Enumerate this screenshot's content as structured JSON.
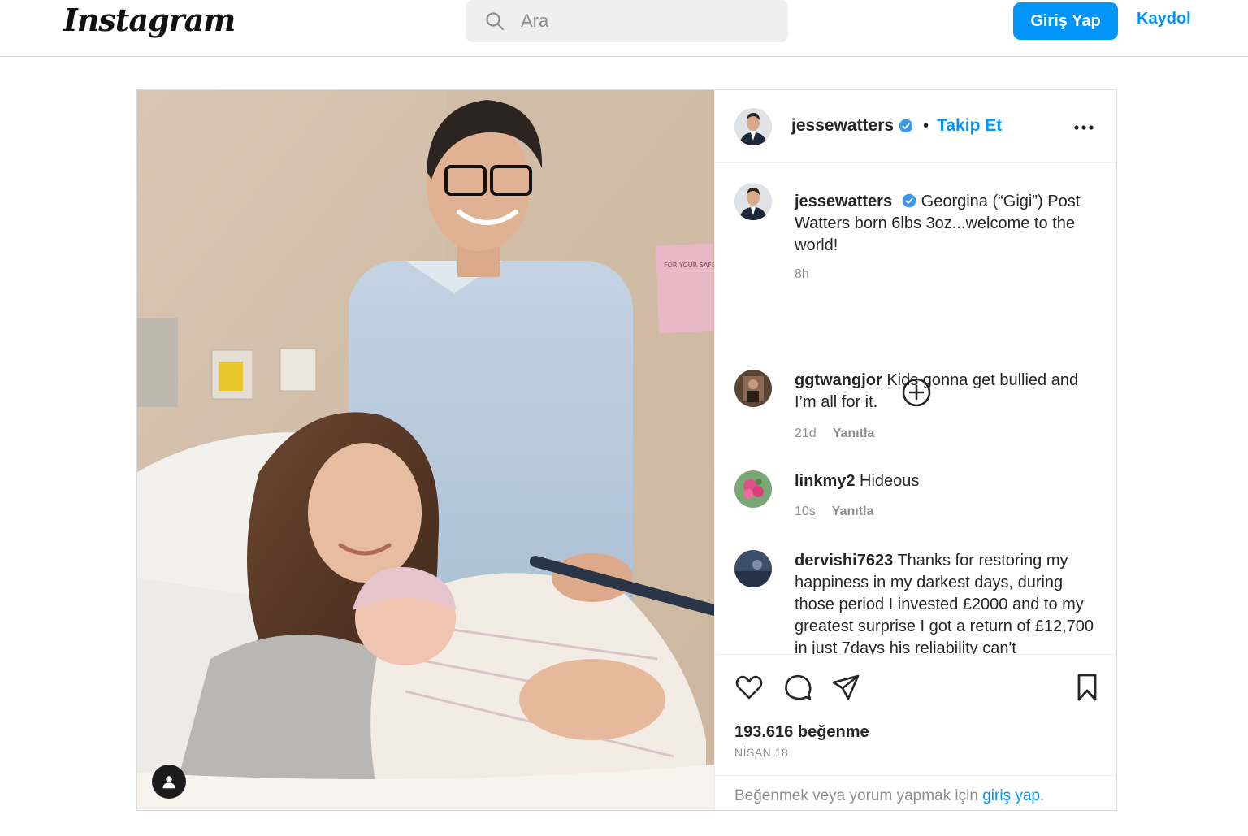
{
  "header": {
    "logo_text": "Instagram",
    "search_placeholder": "Ara",
    "login_label": "Giriş Yap",
    "signup_label": "Kaydol"
  },
  "post": {
    "author": "jessewatters",
    "follow_label": "Takip Et",
    "separator": "•",
    "caption": {
      "username": "jessewatters",
      "text": "Georgina (“Gigi”) Post Watters born 6lbs 3oz...welcome to the world!",
      "time": "8h"
    },
    "sign_text": "FOR YOUR SAFETY / WE ARE REQUESTING / WEAR YOUR MASK / TIMES EXCEPT / THANK",
    "comments": [
      {
        "username": "ggtwangjor",
        "text": "Kids gonna get bullied and I’m all for it.",
        "time": "21d",
        "reply_label": "Yanıtla"
      },
      {
        "username": "linkmy2",
        "text": "Hideous",
        "time": "10s",
        "reply_label": "Yanıtla"
      },
      {
        "username": "dervishi7623",
        "text": "Thanks for restoring my happiness in my darkest days, during those period I invested £2000 and to my greatest surprise I got a return of £12,700 in just 7days his reliability can't",
        "time": "",
        "reply_label": ""
      }
    ],
    "likes": "193.616 beğenme",
    "date": "NİSAN 18",
    "login_prompt": {
      "prefix": "Beğenmek veya yorum yapmak için",
      "link": "giriş yap",
      "suffix": "."
    }
  },
  "icons": {
    "search": "search-icon",
    "verified": "verified-badge-icon",
    "more": "more-options-icon",
    "add": "add-circle-icon",
    "like": "heart-icon",
    "comment": "comment-icon",
    "share": "paper-plane-icon",
    "save": "bookmark-icon",
    "tag": "user-tag-icon"
  },
  "colors": {
    "accent": "#0095f6",
    "border": "#dbdbdb",
    "muted": "#8e8e8e",
    "text": "#262626"
  }
}
